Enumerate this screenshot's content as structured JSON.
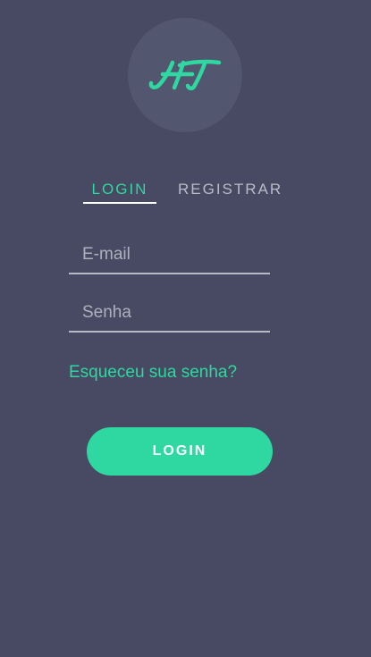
{
  "logo": {
    "icon": "ht-monogram-logo",
    "text": "HT",
    "accent_color": "#2ed8a0"
  },
  "tabs": [
    {
      "label": "LOGIN",
      "active": true
    },
    {
      "label": "REGISTRAR",
      "active": false
    }
  ],
  "form": {
    "email": {
      "placeholder": "E-mail",
      "value": ""
    },
    "password": {
      "placeholder": "Senha",
      "value": ""
    },
    "forgot_password_label": "Esqueceu sua senha?",
    "submit_label": "LOGIN"
  },
  "colors": {
    "background": "#474a62",
    "accent": "#2ed8a0",
    "text_muted": "#b9bbc7"
  }
}
